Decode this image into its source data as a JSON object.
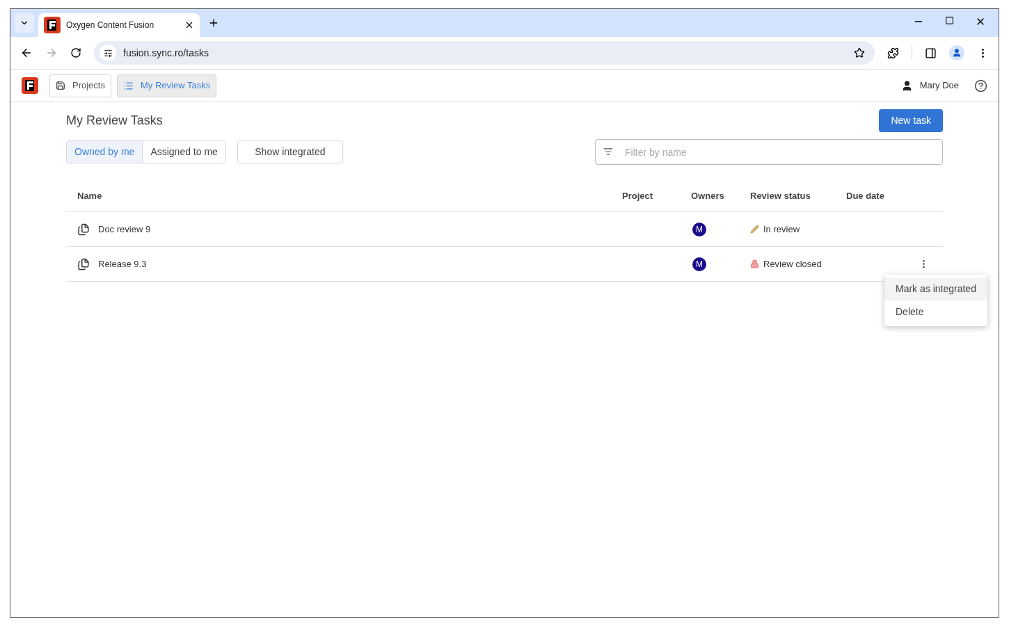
{
  "browser": {
    "tab_title": "Oxygen Content Fusion",
    "url": "fusion.sync.ro/tasks"
  },
  "app_nav": [
    {
      "label": "Projects",
      "selected": false
    },
    {
      "label": "My Review Tasks",
      "selected": true
    }
  ],
  "user": {
    "name": "Mary Doe"
  },
  "page": {
    "title": "My Review Tasks",
    "new_button": "New task"
  },
  "ownership_filter": [
    {
      "label": "Owned by me",
      "selected": true
    },
    {
      "label": "Assigned to me",
      "selected": false
    }
  ],
  "show_integrated": "Show integrated",
  "filter": {
    "placeholder": "Filter by name"
  },
  "table": {
    "columns": [
      "Name",
      "Project",
      "Owners",
      "Review status",
      "Due date"
    ],
    "rows": [
      {
        "name": "Doc review 9",
        "owner": "M",
        "status": "In review",
        "kind": "in_review",
        "actions_shown": false
      },
      {
        "name": "Release 9.3",
        "owner": "M",
        "status": "Review closed",
        "kind": "closed",
        "actions_shown": true
      }
    ]
  },
  "context_menu": [
    {
      "label": "Mark as integrated",
      "highlighted": true
    },
    {
      "label": "Delete",
      "highlighted": false
    }
  ]
}
